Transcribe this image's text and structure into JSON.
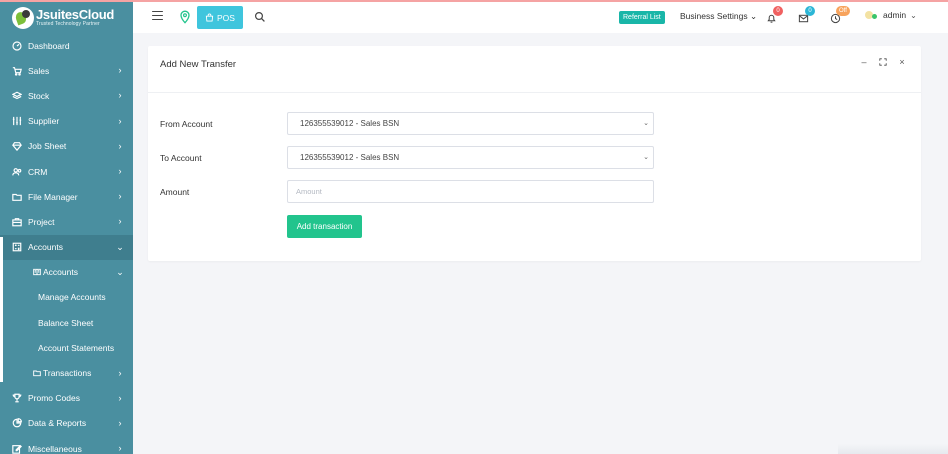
{
  "brand": {
    "name": "JsuitesCloud",
    "tagline": "Trusted Technology Partner"
  },
  "sidebar": {
    "items": [
      {
        "label": "Dashboard",
        "icon": "dashboard-icon"
      },
      {
        "label": "Sales",
        "icon": "cart-icon"
      },
      {
        "label": "Stock",
        "icon": "layers-icon"
      },
      {
        "label": "Supplier",
        "icon": "supplier-icon"
      },
      {
        "label": "Job Sheet",
        "icon": "diamond-icon"
      },
      {
        "label": "CRM",
        "icon": "users-icon"
      },
      {
        "label": "File Manager",
        "icon": "folder-icon"
      },
      {
        "label": "Project",
        "icon": "briefcase-icon"
      },
      {
        "label": "Accounts",
        "icon": "calculator-icon"
      },
      {
        "label": "Accounts",
        "icon": "book-icon"
      },
      {
        "label": "Manage Accounts"
      },
      {
        "label": "Balance Sheet"
      },
      {
        "label": "Account Statements"
      },
      {
        "label": "Transactions",
        "icon": "folder-icon"
      },
      {
        "label": "Promo Codes",
        "icon": "trophy-icon"
      },
      {
        "label": "Data & Reports",
        "icon": "chart-icon"
      },
      {
        "label": "Miscellaneous",
        "icon": "edit-icon"
      }
    ]
  },
  "header": {
    "pos_label": "POS",
    "referral_label": "Referral List",
    "business_settings_label": "Business Settings",
    "notifications_count": "0",
    "messages_count": "0",
    "status_badge": "Off",
    "user_name": "admin"
  },
  "card": {
    "title": "Add New Transfer",
    "from_label": "From Account",
    "from_value": "126355539012 - Sales BSN",
    "to_label": "To Account",
    "to_value": "126355539012 - Sales BSN",
    "amount_label": "Amount",
    "amount_placeholder": "Amount",
    "amount_value": "",
    "submit_label": "Add transaction"
  },
  "colors": {
    "sidebar": "#4a8fa0",
    "pos_button": "#3fc5dd",
    "referral": "#19b6a8",
    "submit": "#22c48d"
  }
}
